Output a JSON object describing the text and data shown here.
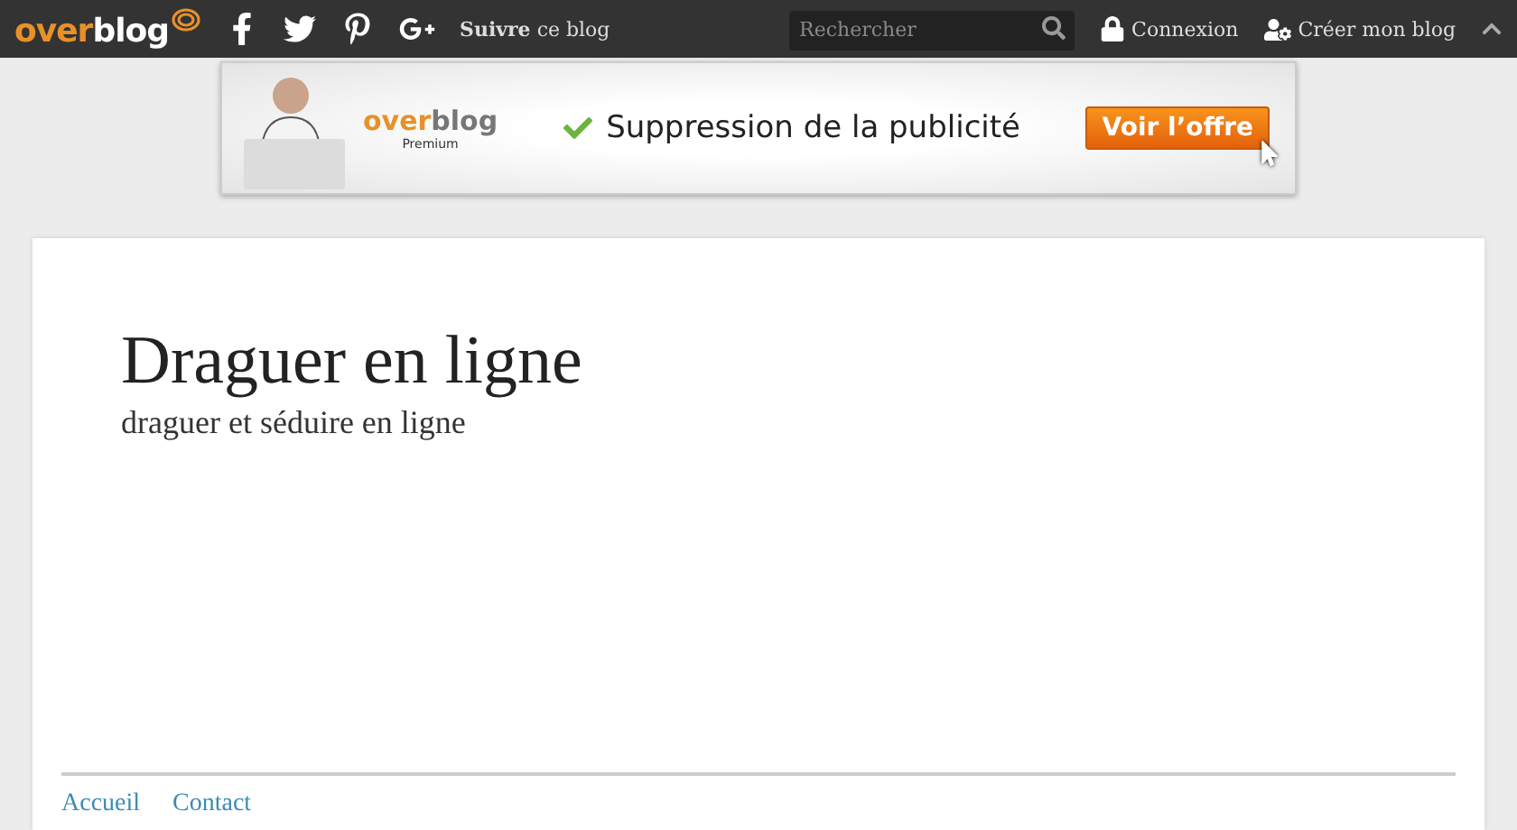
{
  "topbar": {
    "logo": {
      "part_1": "over",
      "part_2": "blog"
    },
    "follow": {
      "bold": "Suivre",
      "rest": "ce blog"
    },
    "search": {
      "placeholder": "Rechercher"
    },
    "links": [
      {
        "kind": "lock",
        "label": "Connexion"
      },
      {
        "kind": "user",
        "label": "Créer mon blog"
      }
    ]
  },
  "ad": {
    "logo": {
      "part_1": "over",
      "part_2": "blog",
      "sub": "Premium"
    },
    "text": "Suppression de la publicité",
    "button": "Voir l’offre"
  },
  "blog": {
    "title": "Draguer en ligne",
    "subtitle": "draguer et séduire en ligne"
  },
  "footer": {
    "links": [
      "Accueil",
      "Contact"
    ]
  }
}
